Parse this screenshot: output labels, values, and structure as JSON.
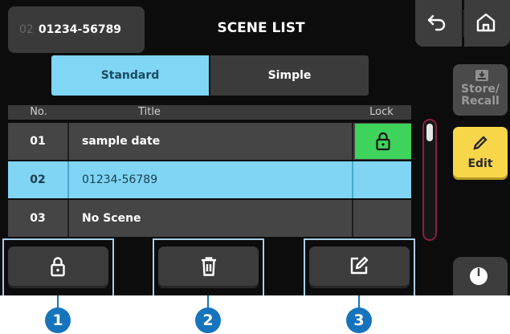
{
  "header": {
    "current_scene_number": "02",
    "current_scene_name": "01234-56789",
    "title": "SCENE LIST",
    "back_icon": "undo-arrow-icon",
    "home_icon": "home-icon"
  },
  "view_tabs": [
    {
      "label": "Standard",
      "selected": true
    },
    {
      "label": "Simple",
      "selected": false
    }
  ],
  "table": {
    "columns": {
      "no": "No.",
      "title": "Title",
      "lock": "Lock"
    },
    "rows": [
      {
        "no": "01",
        "title": "sample date",
        "locked": true,
        "selected": false
      },
      {
        "no": "02",
        "title": "01234-56789",
        "locked": false,
        "selected": true
      },
      {
        "no": "03",
        "title": "No Scene",
        "locked": false,
        "selected": false
      }
    ]
  },
  "sidebar": {
    "store_recall_label": "Store/ Recall",
    "store_recall_line1": "Store/",
    "store_recall_line2": "Recall",
    "edit_label": "Edit"
  },
  "bottom_buttons": [
    {
      "icon": "lock-icon",
      "marker": "1"
    },
    {
      "icon": "trash-icon",
      "marker": "2"
    },
    {
      "icon": "edit-icon",
      "marker": "3"
    }
  ],
  "colors": {
    "accent_blue": "#7fd6f5",
    "lock_green": "#3ed35a",
    "edit_yellow": "#f7d64a",
    "marker_blue": "#1574bb",
    "scrollbar_border": "#8a1f3f"
  }
}
